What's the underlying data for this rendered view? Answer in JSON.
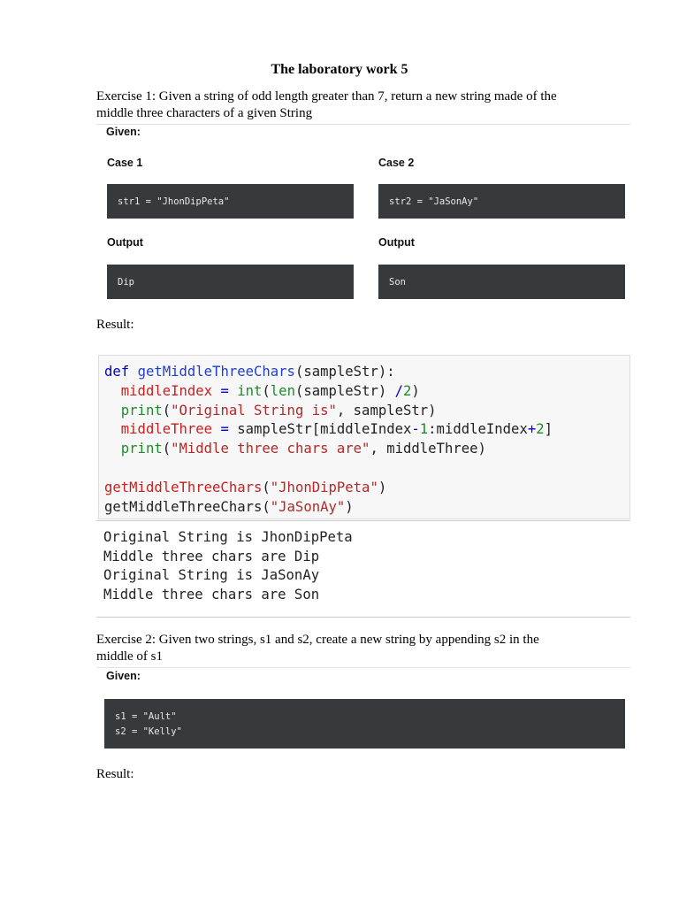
{
  "title": "The laboratory work 5",
  "exercise1": {
    "text_line1": "Exercise 1: Given a string of odd length greater than 7, return a new string made of the",
    "text_line2": "middle three characters of a given String",
    "given_label": "Given:",
    "case1": {
      "label": "Case 1",
      "input": "str1 = \"JhonDipPeta\"",
      "output_label": "Output",
      "output": "Dip"
    },
    "case2": {
      "label": "Case 2",
      "input": "str2 = \"JaSonAy\"",
      "output_label": "Output",
      "output": "Son"
    },
    "result_label": "Result:",
    "output_lines": [
      "Original String is JhonDipPeta",
      "Middle three chars are Dip",
      "Original String is JaSonAy",
      "Middle three chars are Son"
    ]
  },
  "exercise2": {
    "text_line1": "Exercise 2: Given two strings, s1 and s2, create a new string by appending s2 in the",
    "text_line2": "middle of s1",
    "given_label": "Given:",
    "given_lines": [
      "s1 = \"Ault\"",
      "s2 = \"Kelly\""
    ],
    "result_label": "Result:"
  }
}
